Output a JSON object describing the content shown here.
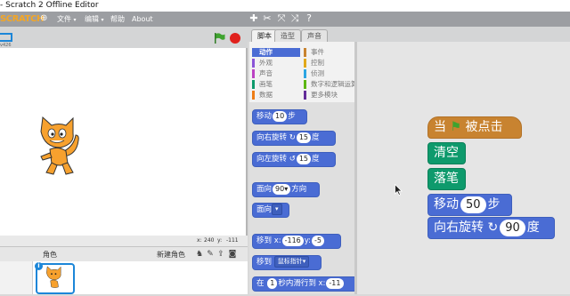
{
  "window": {
    "title": "- Scratch 2 Offline Editor"
  },
  "menubar": {
    "logo": "SCRATCH",
    "file": "文件",
    "edit": "编辑",
    "help": "帮助",
    "about": "About",
    "tools": [
      "duplicate-icon",
      "delete-icon",
      "grow-icon",
      "shrink-icon",
      "help-icon"
    ]
  },
  "stage": {
    "version_label": "v426",
    "coords": {
      "x_label": "x:",
      "x_value": "240",
      "y_label": "y:",
      "y_value": "-111"
    }
  },
  "sprite_pane": {
    "stage_col_label": "",
    "sprites_label": "角色",
    "new_sprite_label": "新建角色"
  },
  "tabs": [
    {
      "label": "脚本",
      "active": true
    },
    {
      "label": "造型",
      "active": false
    },
    {
      "label": "声音",
      "active": false
    }
  ],
  "categories": {
    "left": [
      {
        "label": "动作",
        "color": "#4a6cd4",
        "active": true
      },
      {
        "label": "外观",
        "color": "#8a55d7"
      },
      {
        "label": "声音",
        "color": "#bb42c3"
      },
      {
        "label": "画笔",
        "color": "#0e9a6c"
      },
      {
        "label": "数据",
        "color": "#ee7d16"
      }
    ],
    "right": [
      {
        "label": "事件",
        "color": "#c88330"
      },
      {
        "label": "控制",
        "color": "#e1a91a"
      },
      {
        "label": "侦测",
        "color": "#2ca5e2"
      },
      {
        "label": "数字和逻辑运算",
        "color": "#5cb712"
      },
      {
        "label": "更多模块",
        "color": "#632d99"
      }
    ]
  },
  "palette": {
    "move": {
      "pre": "移动",
      "value": "10",
      "post": "步"
    },
    "turn_right": {
      "pre": "向右旋转",
      "icon": "↻",
      "value": "15",
      "post": "度"
    },
    "turn_left": {
      "pre": "向左旋转",
      "icon": "↺",
      "value": "15",
      "post": "度"
    },
    "point_dir": {
      "pre": "面向",
      "value": "90▾",
      "post": "方向"
    },
    "point_towards": {
      "pre": "面向",
      "value": "▾"
    },
    "goto_xy": {
      "pre": "移到 x:",
      "x": "-116",
      "mid": "y:",
      "y": "-5"
    },
    "goto": {
      "pre": "移到",
      "value": "鼠标指针▾"
    },
    "glide": {
      "pre": "在",
      "value": "1",
      "mid": "秒内滑行到 x:",
      "x": "-11"
    }
  },
  "script": {
    "hat": {
      "pre": "当",
      "post": "被点击"
    },
    "clear": "清空",
    "pen_down": "落笔",
    "move": {
      "pre": "移动",
      "value": "50",
      "post": "步"
    },
    "turn": {
      "pre": "向右旋转",
      "icon": "↻",
      "value": "90",
      "post": "度"
    }
  },
  "colors": {
    "motion": "#4a6cd4",
    "pen": "#0e9a6c",
    "event": "#c88330",
    "accent": "#1c86d8",
    "stop": "#e0201c"
  }
}
